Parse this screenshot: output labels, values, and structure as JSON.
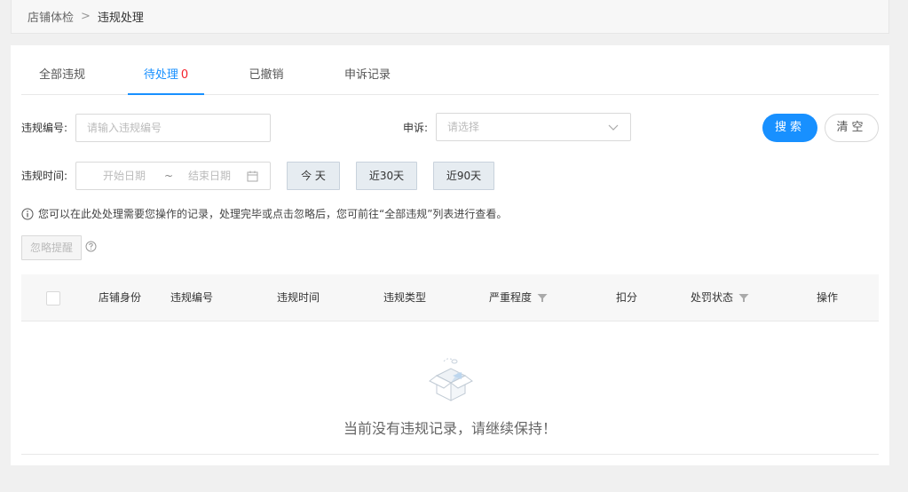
{
  "breadcrumb": {
    "parent": "店铺体检",
    "separator": ">",
    "current": "违规处理"
  },
  "tabs": [
    {
      "label": "全部违规"
    },
    {
      "label": "待处理",
      "count": "0"
    },
    {
      "label": "已撤销"
    },
    {
      "label": "申诉记录"
    }
  ],
  "filters": {
    "violation_no_label": "违规编号:",
    "violation_no_placeholder": "请输入违规编号",
    "appeal_label": "申诉:",
    "appeal_placeholder": "请选择",
    "time_label": "违规时间:",
    "start_placeholder": "开始日期",
    "range_separator": "~",
    "end_placeholder": "结束日期",
    "today_label": "今 天",
    "last30_label": "近30天",
    "last90_label": "近90天",
    "search_label": "搜索",
    "clear_label": "清空"
  },
  "notice": "您可以在此处处理需要您操作的记录，处理完毕或点击忽略后，您可前往“全部违规”列表进行查看。",
  "ignore_label": "忽略提醒",
  "table": {
    "columns": [
      "店铺身份",
      "违规编号",
      "违规时间",
      "违规类型",
      "严重程度",
      "扣分",
      "处罚状态",
      "操作"
    ]
  },
  "empty_text": "当前没有违规记录，请继续保持！",
  "colors": {
    "accent": "#1890ff",
    "count": "#f5222d"
  }
}
